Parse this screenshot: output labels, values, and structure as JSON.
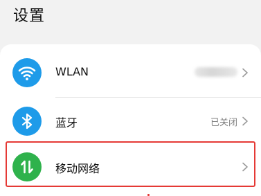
{
  "header": {
    "title": "设置"
  },
  "settings": {
    "items": [
      {
        "id": "wlan",
        "label": "WLAN",
        "icon": "wifi-icon",
        "icon_color": "#1e9be9",
        "value": ""
      },
      {
        "id": "bluetooth",
        "label": "蓝牙",
        "icon": "bluetooth-icon",
        "icon_color": "#1e9be9",
        "value": "已关闭"
      },
      {
        "id": "mobile-network",
        "label": "移动网络",
        "icon": "mobile-data-icon",
        "icon_color": "#2fb24c",
        "value": ""
      }
    ]
  },
  "colors": {
    "highlight": "#e53935",
    "background": "#f2f2f2"
  }
}
